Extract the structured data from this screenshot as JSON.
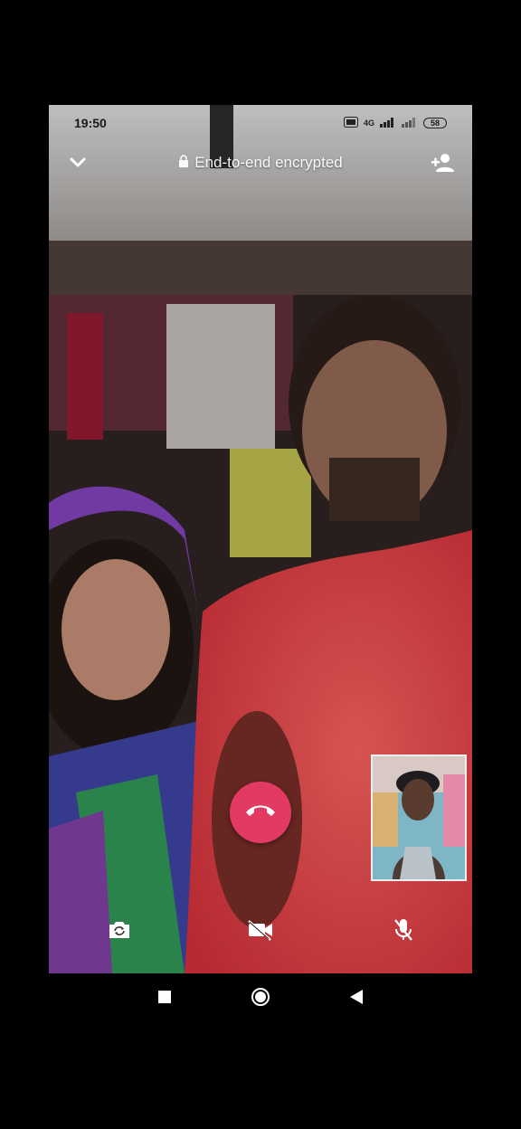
{
  "status_bar": {
    "time": "19:50",
    "network": "4G",
    "battery": "58"
  },
  "header": {
    "encryption_text": "End-to-end encrypted"
  },
  "icons": {
    "back": "chevron-down-icon",
    "lock": "lock-icon",
    "add_participant": "add-person-icon",
    "end_call": "phone-hangup-icon",
    "switch_camera": "switch-camera-icon",
    "video_off": "video-off-icon",
    "mic_off": "mic-off-icon",
    "nav_recent": "square-icon",
    "nav_home": "circle-icon",
    "nav_back": "triangle-back-icon"
  },
  "colors": {
    "end_call": "#e23a62",
    "controls": "#ffffff"
  }
}
